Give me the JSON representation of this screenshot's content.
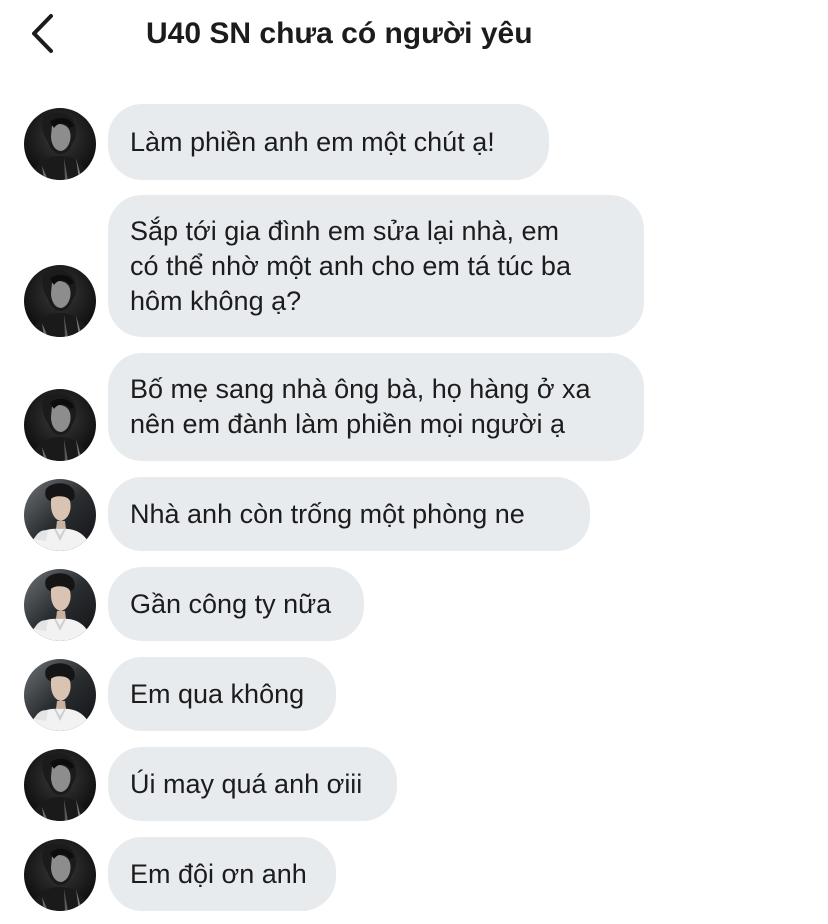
{
  "header": {
    "back_icon": "chevron-left-icon",
    "title": "U40 SN chưa có người yêu"
  },
  "messages": [
    {
      "sender": "user-a",
      "avatar": "dark-portrait",
      "text": "Làm phiền anh em một chút ạ!"
    },
    {
      "sender": "user-a",
      "avatar": "dark-portrait",
      "text": "Sắp tới gia đình em sửa lại nhà, em\ncó thể nhờ một anh cho em tá túc ba\nhôm không ạ?"
    },
    {
      "sender": "user-a",
      "avatar": "dark-portrait",
      "text": "Bố mẹ sang nhà ông bà, họ hàng ở xa\nnên em đành làm phiền mọi người ạ"
    },
    {
      "sender": "user-b",
      "avatar": "white-suit-portrait",
      "text": "Nhà anh còn trống một phòng ne"
    },
    {
      "sender": "user-b",
      "avatar": "white-suit-portrait",
      "text": "Gần công ty nữa"
    },
    {
      "sender": "user-b",
      "avatar": "white-suit-portrait",
      "text": "Em qua không"
    },
    {
      "sender": "user-a",
      "avatar": "dark-portrait",
      "text": "Úi may quá anh ơiii"
    },
    {
      "sender": "user-a",
      "avatar": "dark-portrait",
      "text": "Em đội ơn anh"
    }
  ]
}
